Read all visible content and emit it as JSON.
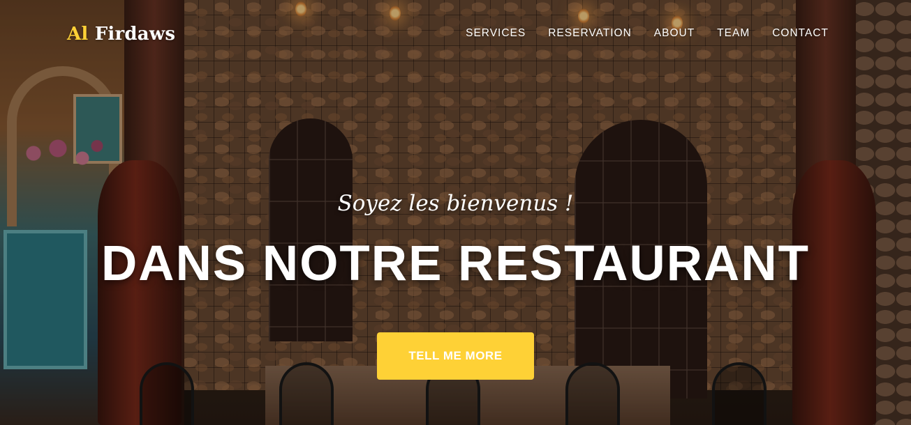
{
  "brand": {
    "first": "Al",
    "second": "Firdaws"
  },
  "nav": {
    "items": [
      {
        "label": "SERVICES"
      },
      {
        "label": "RESERVATION"
      },
      {
        "label": "ABOUT"
      },
      {
        "label": "TEAM"
      },
      {
        "label": "CONTACT"
      }
    ]
  },
  "hero": {
    "subheading": "Soyez les bienvenus !",
    "heading": "DANS NOTRE RESTAURANT",
    "cta_label": "TELL ME MORE",
    "background_image": "restaurant-terrace-photo"
  },
  "colors": {
    "accent": "#fed136",
    "text": "#ffffff"
  }
}
